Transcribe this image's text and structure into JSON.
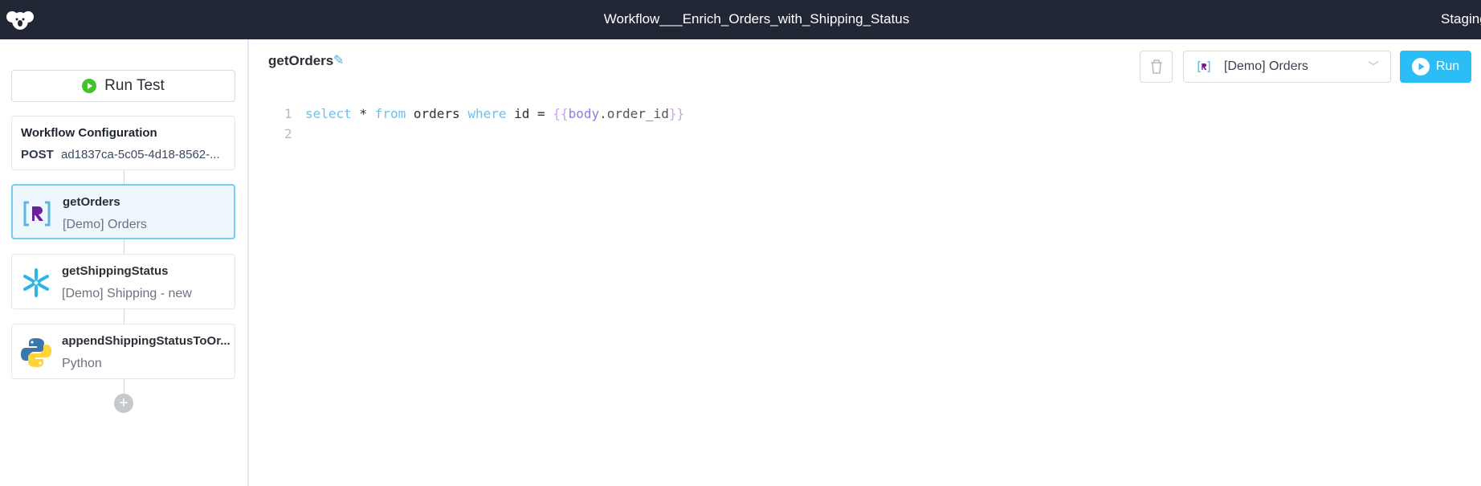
{
  "header": {
    "title": "Workflow___Enrich_Orders_with_Shipping_Status",
    "environment": "Staging"
  },
  "sidebar": {
    "run_test_label": "Run Test",
    "config": {
      "title": "Workflow Configuration",
      "method": "POST",
      "endpoint": "ad1837ca-5c05-4d18-8562-..."
    },
    "steps": [
      {
        "name": "getOrders",
        "resource": "[Demo] Orders",
        "icon": "retool-db-icon",
        "selected": true
      },
      {
        "name": "getShippingStatus",
        "resource": "[Demo] Shipping - new",
        "icon": "snowflake-icon"
      },
      {
        "name": "appendShippingStatusToOr...",
        "resource": "Python",
        "icon": "python-icon"
      }
    ]
  },
  "editor": {
    "query_name": "getOrders",
    "resource": "[Demo] Orders",
    "run_label": "Run",
    "lines": [
      {
        "n": "1",
        "tokens": [
          "select",
          "*",
          "from",
          "orders",
          "where",
          "id",
          "=",
          "{{",
          "body",
          ".order_id",
          "}}"
        ]
      },
      {
        "n": "2"
      }
    ]
  },
  "colors": {
    "header_bg": "#212734",
    "accent": "#2bbdf6",
    "run_test_green": "#44c22b"
  }
}
